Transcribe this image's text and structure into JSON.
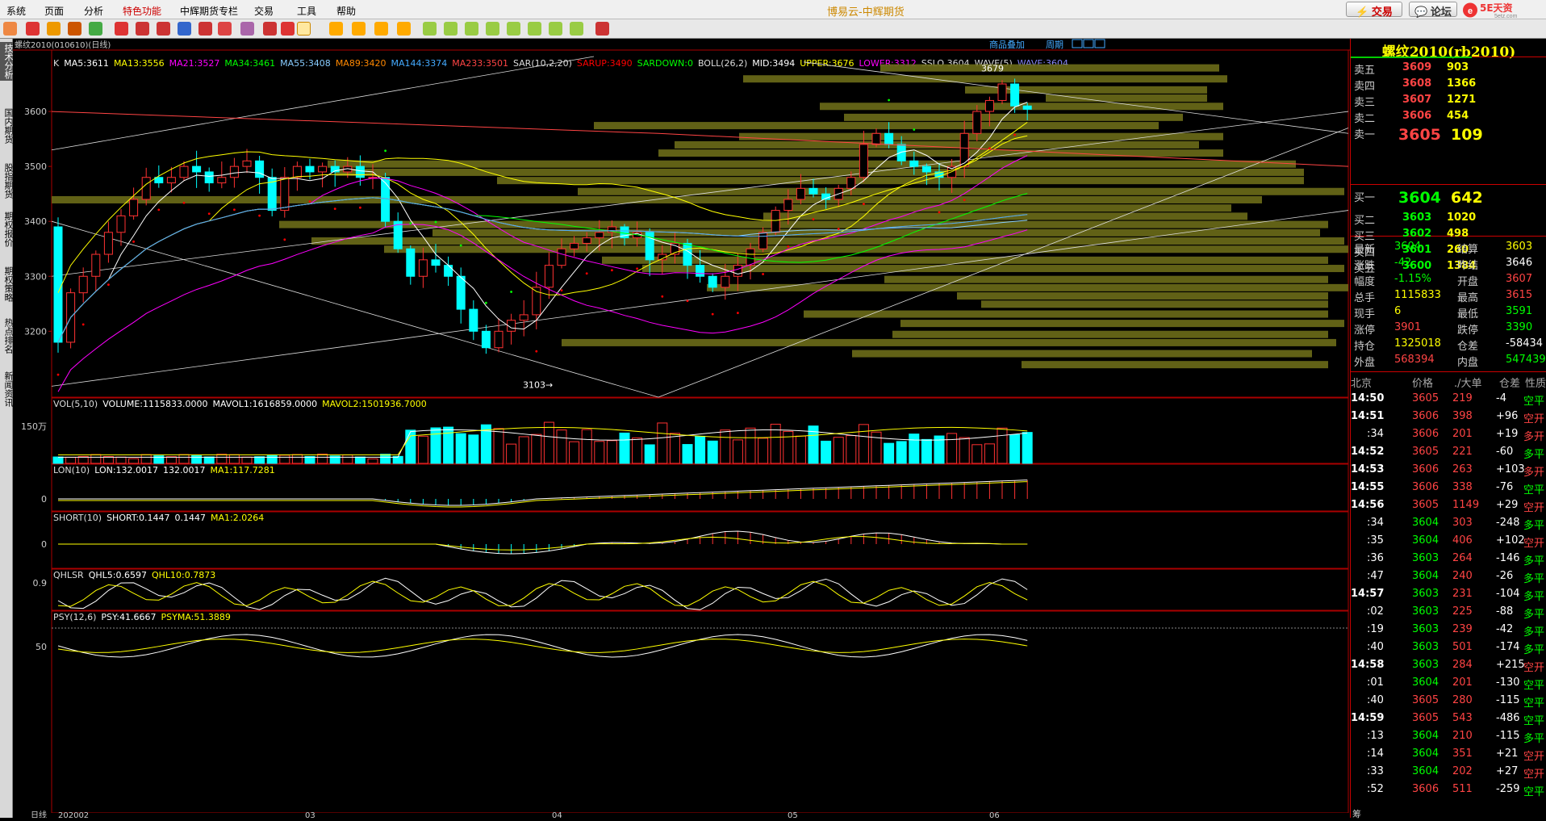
{
  "menu": [
    "系统",
    "页面",
    "分析",
    "特色功能",
    "中辉期货专栏",
    "交易",
    "工具",
    "帮助"
  ],
  "app_title": "博易云-中辉期货",
  "buttons": {
    "trade": "⚡ 交易",
    "forum": "💬 论坛"
  },
  "logo_text": "5E天资",
  "logo_sub": "5etz.com",
  "side_tabs": [
    "技术分析",
    "国内期货",
    "股指期货",
    "期权报价",
    "期权策略",
    "热点排名",
    "新闻资讯"
  ],
  "chart_header": {
    "symbol": "螺纹2010(010610)(日线)",
    "link1": "商品叠加",
    "link2": "周期"
  },
  "indicators": {
    "main": [
      {
        "t": "K",
        "c": "#ddd"
      },
      {
        "t": "MA5:3611",
        "c": "#fff"
      },
      {
        "t": "MA13:3556",
        "c": "#ff0"
      },
      {
        "t": "MA21:3527",
        "c": "#f0f"
      },
      {
        "t": "MA34:3461",
        "c": "#0f0"
      },
      {
        "t": "MA55:3408",
        "c": "#8cf"
      },
      {
        "t": "MA89:3420",
        "c": "#f80"
      },
      {
        "t": "MA144:3374",
        "c": "#4af"
      },
      {
        "t": "MA233:3501",
        "c": "#f44"
      },
      {
        "t": "SAR(10,2,20)",
        "c": "#ddd"
      },
      {
        "t": "SARUP:3490",
        "c": "#f00"
      },
      {
        "t": "SARDOWN:0",
        "c": "#0f0"
      },
      {
        "t": "BOLL(26,2)",
        "c": "#ddd"
      },
      {
        "t": "MID:3494",
        "c": "#fff"
      },
      {
        "t": "UPPER:3676",
        "c": "#ff0"
      },
      {
        "t": "LOWER:3312",
        "c": "#f0f"
      },
      {
        "t": "SSLO 3604",
        "c": "#ddd"
      },
      {
        "t": "WAVE(5)",
        "c": "#ddd"
      },
      {
        "t": "WAVE:3604",
        "c": "#88f"
      }
    ],
    "vol": [
      {
        "t": "VOL(5,10)",
        "c": "#ddd"
      },
      {
        "t": "VOLUME:1115833.0000",
        "c": "#fff"
      },
      {
        "t": "MAVOL1:1616859.0000",
        "c": "#fff"
      },
      {
        "t": "MAVOL2:1501936.7000",
        "c": "#ff0"
      }
    ],
    "lon": [
      {
        "t": "LON(10)",
        "c": "#ddd"
      },
      {
        "t": "LON:132.0017",
        "c": "#fff"
      },
      {
        "t": "132.0017",
        "c": "#fff"
      },
      {
        "t": "MA1:117.7281",
        "c": "#ff0"
      }
    ],
    "short": [
      {
        "t": "SHORT(10)",
        "c": "#ddd"
      },
      {
        "t": "SHORT:0.1447",
        "c": "#fff"
      },
      {
        "t": "0.1447",
        "c": "#fff"
      },
      {
        "t": "MA1:2.0264",
        "c": "#ff0"
      }
    ],
    "qhlsr": [
      {
        "t": "QHLSR",
        "c": "#ddd"
      },
      {
        "t": "QHL5:0.6597",
        "c": "#fff"
      },
      {
        "t": "QHL10:0.7873",
        "c": "#ff0"
      }
    ],
    "psy": [
      {
        "t": "PSY(12,6)",
        "c": "#ddd"
      },
      {
        "t": "PSY:41.6667",
        "c": "#fff"
      },
      {
        "t": "PSYMA:51.3889",
        "c": "#ff0"
      }
    ]
  },
  "price_axis": [
    "3600",
    "3500",
    "3400",
    "3300",
    "3200"
  ],
  "vol_axis": "150万",
  "lon_axis": "0",
  "short_axis": "0",
  "qhlsr_axis": "0.9",
  "psy_axis": "50",
  "annotations": {
    "high": "3679",
    "low": "3103→"
  },
  "x_axis": {
    "label": "日线",
    "ticks": [
      "202002",
      "03",
      "04",
      "05",
      "06"
    ]
  },
  "quote": {
    "title": "螺纹2010(rb2010)",
    "asks": [
      [
        "卖五",
        "3609",
        "903"
      ],
      [
        "卖四",
        "3608",
        "1366"
      ],
      [
        "卖三",
        "3607",
        "1271"
      ],
      [
        "卖二",
        "3606",
        "454"
      ],
      [
        "卖一",
        "3605",
        "109"
      ]
    ],
    "bids": [
      [
        "买一",
        "3604",
        "642"
      ],
      [
        "买二",
        "3603",
        "1020"
      ],
      [
        "买三",
        "3602",
        "498"
      ],
      [
        "买四",
        "3601",
        "260"
      ],
      [
        "买五",
        "3600",
        "1384"
      ]
    ],
    "stats": [
      [
        "最新",
        "3604",
        "结算",
        "3603"
      ],
      [
        "涨跌",
        "-42",
        "昨结",
        "3646"
      ],
      [
        "幅度",
        "-1.15%",
        "开盘",
        "3607"
      ],
      [
        "总手",
        "1115833",
        "最高",
        "3615"
      ],
      [
        "现手",
        "6",
        "最低",
        "3591"
      ],
      [
        "涨停",
        "3901",
        "跌停",
        "3390"
      ],
      [
        "持仓",
        "1325018",
        "仓差",
        "-58434"
      ],
      [
        "外盘",
        "568394",
        "内盘",
        "547439"
      ]
    ],
    "ts_header": [
      "北京",
      "价格",
      "./大单",
      "仓差",
      "性质"
    ],
    "ts": [
      [
        "14:50",
        "3605",
        "219",
        "-4",
        "空平"
      ],
      [
        "14:51",
        "3606",
        "398",
        "+96",
        "空开"
      ],
      [
        ":34",
        "3606",
        "201",
        "+19",
        "多开"
      ],
      [
        "14:52",
        "3605",
        "221",
        "-60",
        "多平"
      ],
      [
        "14:53",
        "3606",
        "263",
        "+103",
        "多开"
      ],
      [
        "14:55",
        "3606",
        "338",
        "-76",
        "空平"
      ],
      [
        "14:56",
        "3605",
        "1149",
        "+29",
        "空开"
      ],
      [
        ":34",
        "3604",
        "303",
        "-248",
        "多平"
      ],
      [
        ":35",
        "3604",
        "406",
        "+102",
        "空开"
      ],
      [
        ":36",
        "3603",
        "264",
        "-146",
        "多平"
      ],
      [
        ":47",
        "3604",
        "240",
        "-26",
        "多平"
      ],
      [
        "14:57",
        "3603",
        "231",
        "-104",
        "多平"
      ],
      [
        ":02",
        "3603",
        "225",
        "-88",
        "多平"
      ],
      [
        ":19",
        "3603",
        "239",
        "-42",
        "多平"
      ],
      [
        ":40",
        "3603",
        "501",
        "-174",
        "多平"
      ],
      [
        "14:58",
        "3603",
        "284",
        "+215",
        "空开"
      ],
      [
        ":01",
        "3604",
        "201",
        "-130",
        "空平"
      ],
      [
        ":40",
        "3605",
        "280",
        "-115",
        "空平"
      ],
      [
        "14:59",
        "3605",
        "543",
        "-486",
        "空平"
      ],
      [
        ":13",
        "3604",
        "210",
        "-115",
        "多平"
      ],
      [
        ":14",
        "3604",
        "351",
        "+21",
        "空开"
      ],
      [
        ":33",
        "3604",
        "202",
        "+27",
        "空开"
      ],
      [
        ":52",
        "3606",
        "511",
        "-259",
        "空平"
      ]
    ],
    "bottom_label": "筹"
  },
  "colors": {
    "up": "#ff3232",
    "down": "#00ffff",
    "accent": "#ffff00"
  }
}
